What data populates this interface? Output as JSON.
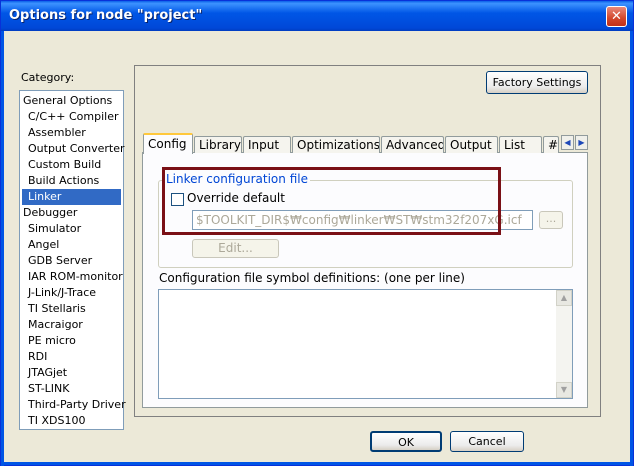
{
  "window": {
    "title": "Options for node \"project\"",
    "close_glyph": "✕"
  },
  "category": {
    "label": "Category:",
    "items": [
      "General Options",
      "C/C++ Compiler",
      "Assembler",
      "Output Converter",
      "Custom Build",
      "Build Actions",
      "Linker",
      "Debugger",
      "Simulator",
      "Angel",
      "GDB Server",
      "IAR ROM-monitor",
      "J-Link/J-Trace",
      "TI Stellaris",
      "Macraigor",
      "PE micro",
      "RDI",
      "JTAGjet",
      "ST-LINK",
      "Third-Party Driver",
      "TI XDS100"
    ],
    "selected": "Linker"
  },
  "factory_settings_label": "Factory Settings",
  "tabs": [
    "Config",
    "Library",
    "Input",
    "Optimizations",
    "Advanced",
    "Output",
    "List",
    "#"
  ],
  "active_tab": "Config",
  "linker_config": {
    "group_title": "Linker configuration file",
    "override_label": "Override default",
    "override_checked": false,
    "path_value": "$TOOLKIT_DIR$₩config₩linker₩ST₩stm32f207xG.icf",
    "browse_label": "...",
    "edit_label": "Edit..."
  },
  "symbol_defs_label": "Configuration file symbol definitions: (one per line)",
  "buttons": {
    "ok": "OK",
    "cancel": "Cancel"
  },
  "icons": {
    "scroll_left": "◀",
    "scroll_right": "▶",
    "scroll_up": "▲",
    "scroll_down": "▼"
  },
  "colors": {
    "selection": "#316ac5",
    "highlight_box": "#7a1016",
    "group_title": "#0046d5",
    "active_tab_accent": "#ffc83c"
  }
}
